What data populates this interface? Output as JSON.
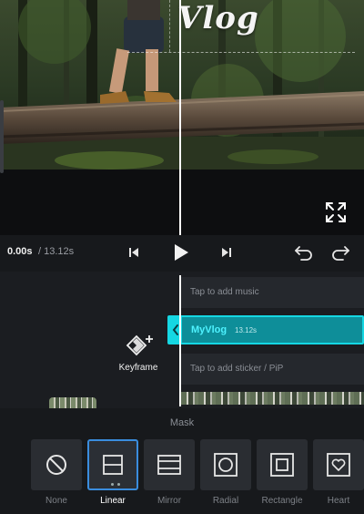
{
  "preview": {
    "overlay_text": "Vlog",
    "icons": {
      "fullscreen": "fullscreen-expand-icon"
    }
  },
  "controls": {
    "time_current": "0.00s",
    "time_total": "/ 13.12s",
    "icons": {
      "prev": "skip-to-start-icon",
      "play": "play-icon",
      "next": "skip-to-end-icon",
      "undo": "undo-icon",
      "redo": "redo-icon"
    }
  },
  "timeline": {
    "music_placeholder": "Tap to add music",
    "clip_name": "MyVlog",
    "clip_duration": "13.12s",
    "sticker_placeholder": "Tap to add sticker / PiP",
    "keyframe_label": "Keyframe",
    "icons": {
      "keyframe": "keyframe-add-icon",
      "clip_handle": "chevron-left-icon"
    }
  },
  "mask": {
    "title": "Mask",
    "selected": "Linear",
    "options": [
      {
        "label": "None",
        "icon": "none-circle-slash-icon"
      },
      {
        "label": "Linear",
        "icon": "linear-mask-icon"
      },
      {
        "label": "Mirror",
        "icon": "mirror-mask-icon"
      },
      {
        "label": "Radial",
        "icon": "radial-mask-icon"
      },
      {
        "label": "Rectangle",
        "icon": "rectangle-mask-icon"
      },
      {
        "label": "Heart",
        "icon": "heart-mask-icon"
      }
    ]
  },
  "colors": {
    "accent_cyan": "#15d7e3",
    "clip_fill": "#0e8e99",
    "selection_blue": "#3a8dde",
    "background": "#17191c"
  }
}
